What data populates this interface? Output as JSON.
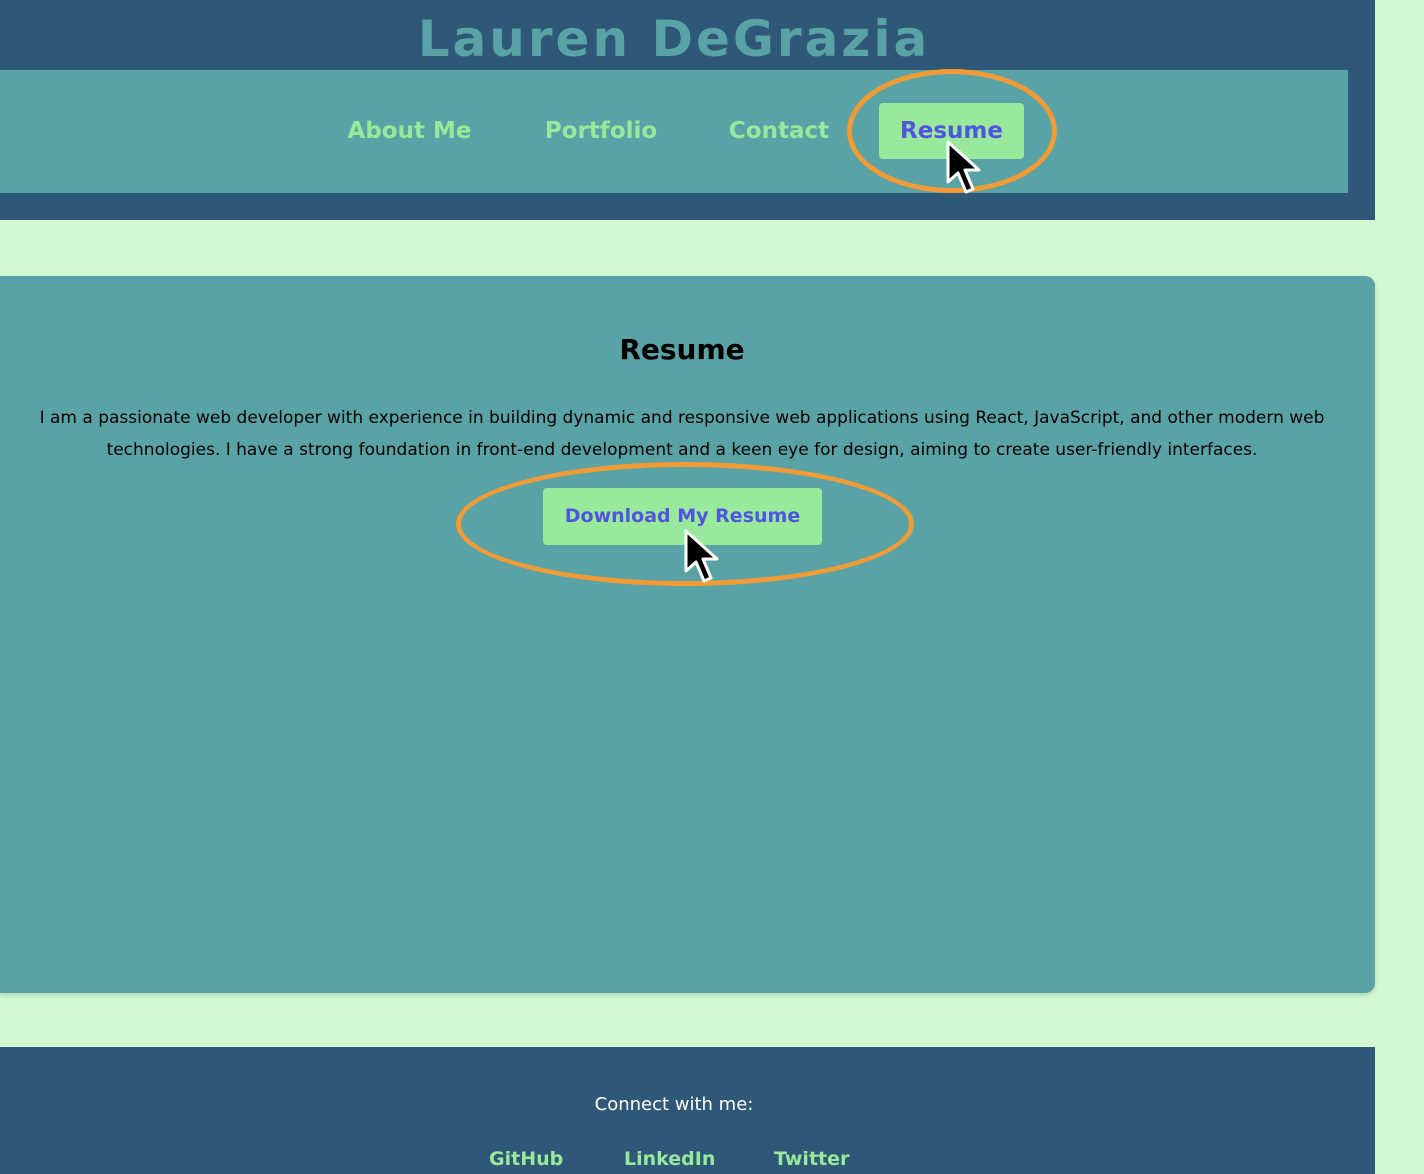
{
  "header": {
    "site_title": "Lauren DeGrazia"
  },
  "nav": {
    "items": [
      {
        "label": "About Me"
      },
      {
        "label": "Portfolio"
      },
      {
        "label": "Contact"
      },
      {
        "label": "Resume",
        "active": true
      }
    ]
  },
  "main": {
    "section_title": "Resume",
    "description": "I am a passionate web developer with experience in building dynamic and responsive web applications using React, JavaScript, and other modern web technologies. I have a strong foundation in front-end development and a keen eye for design, aiming to create user-friendly interfaces.",
    "download_label": "Download My Resume"
  },
  "footer": {
    "connect_text": "Connect with me:",
    "links": [
      {
        "label": "GitHub"
      },
      {
        "label": "LinkedIn"
      },
      {
        "label": "Twitter"
      }
    ]
  },
  "colors": {
    "background": "#d2f8d2",
    "header_bg": "#2f5777",
    "teal": "#59a3a6",
    "mint": "#98e99b",
    "accent_text": "#5154e1",
    "highlight": "#f29b34"
  },
  "icons": {
    "cursor": "mouse-pointer-icon"
  }
}
